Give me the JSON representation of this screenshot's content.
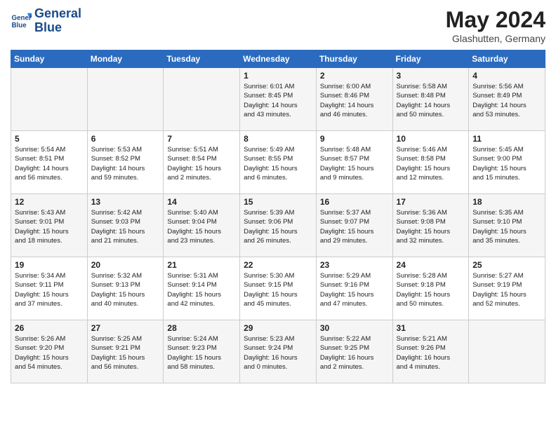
{
  "header": {
    "logo_line1": "General",
    "logo_line2": "Blue",
    "month": "May 2024",
    "location": "Glashutten, Germany"
  },
  "weekdays": [
    "Sunday",
    "Monday",
    "Tuesday",
    "Wednesday",
    "Thursday",
    "Friday",
    "Saturday"
  ],
  "weeks": [
    [
      {
        "day": "",
        "detail": ""
      },
      {
        "day": "",
        "detail": ""
      },
      {
        "day": "",
        "detail": ""
      },
      {
        "day": "1",
        "detail": "Sunrise: 6:01 AM\nSunset: 8:45 PM\nDaylight: 14 hours\nand 43 minutes."
      },
      {
        "day": "2",
        "detail": "Sunrise: 6:00 AM\nSunset: 8:46 PM\nDaylight: 14 hours\nand 46 minutes."
      },
      {
        "day": "3",
        "detail": "Sunrise: 5:58 AM\nSunset: 8:48 PM\nDaylight: 14 hours\nand 50 minutes."
      },
      {
        "day": "4",
        "detail": "Sunrise: 5:56 AM\nSunset: 8:49 PM\nDaylight: 14 hours\nand 53 minutes."
      }
    ],
    [
      {
        "day": "5",
        "detail": "Sunrise: 5:54 AM\nSunset: 8:51 PM\nDaylight: 14 hours\nand 56 minutes."
      },
      {
        "day": "6",
        "detail": "Sunrise: 5:53 AM\nSunset: 8:52 PM\nDaylight: 14 hours\nand 59 minutes."
      },
      {
        "day": "7",
        "detail": "Sunrise: 5:51 AM\nSunset: 8:54 PM\nDaylight: 15 hours\nand 2 minutes."
      },
      {
        "day": "8",
        "detail": "Sunrise: 5:49 AM\nSunset: 8:55 PM\nDaylight: 15 hours\nand 6 minutes."
      },
      {
        "day": "9",
        "detail": "Sunrise: 5:48 AM\nSunset: 8:57 PM\nDaylight: 15 hours\nand 9 minutes."
      },
      {
        "day": "10",
        "detail": "Sunrise: 5:46 AM\nSunset: 8:58 PM\nDaylight: 15 hours\nand 12 minutes."
      },
      {
        "day": "11",
        "detail": "Sunrise: 5:45 AM\nSunset: 9:00 PM\nDaylight: 15 hours\nand 15 minutes."
      }
    ],
    [
      {
        "day": "12",
        "detail": "Sunrise: 5:43 AM\nSunset: 9:01 PM\nDaylight: 15 hours\nand 18 minutes."
      },
      {
        "day": "13",
        "detail": "Sunrise: 5:42 AM\nSunset: 9:03 PM\nDaylight: 15 hours\nand 21 minutes."
      },
      {
        "day": "14",
        "detail": "Sunrise: 5:40 AM\nSunset: 9:04 PM\nDaylight: 15 hours\nand 23 minutes."
      },
      {
        "day": "15",
        "detail": "Sunrise: 5:39 AM\nSunset: 9:06 PM\nDaylight: 15 hours\nand 26 minutes."
      },
      {
        "day": "16",
        "detail": "Sunrise: 5:37 AM\nSunset: 9:07 PM\nDaylight: 15 hours\nand 29 minutes."
      },
      {
        "day": "17",
        "detail": "Sunrise: 5:36 AM\nSunset: 9:08 PM\nDaylight: 15 hours\nand 32 minutes."
      },
      {
        "day": "18",
        "detail": "Sunrise: 5:35 AM\nSunset: 9:10 PM\nDaylight: 15 hours\nand 35 minutes."
      }
    ],
    [
      {
        "day": "19",
        "detail": "Sunrise: 5:34 AM\nSunset: 9:11 PM\nDaylight: 15 hours\nand 37 minutes."
      },
      {
        "day": "20",
        "detail": "Sunrise: 5:32 AM\nSunset: 9:13 PM\nDaylight: 15 hours\nand 40 minutes."
      },
      {
        "day": "21",
        "detail": "Sunrise: 5:31 AM\nSunset: 9:14 PM\nDaylight: 15 hours\nand 42 minutes."
      },
      {
        "day": "22",
        "detail": "Sunrise: 5:30 AM\nSunset: 9:15 PM\nDaylight: 15 hours\nand 45 minutes."
      },
      {
        "day": "23",
        "detail": "Sunrise: 5:29 AM\nSunset: 9:16 PM\nDaylight: 15 hours\nand 47 minutes."
      },
      {
        "day": "24",
        "detail": "Sunrise: 5:28 AM\nSunset: 9:18 PM\nDaylight: 15 hours\nand 50 minutes."
      },
      {
        "day": "25",
        "detail": "Sunrise: 5:27 AM\nSunset: 9:19 PM\nDaylight: 15 hours\nand 52 minutes."
      }
    ],
    [
      {
        "day": "26",
        "detail": "Sunrise: 5:26 AM\nSunset: 9:20 PM\nDaylight: 15 hours\nand 54 minutes."
      },
      {
        "day": "27",
        "detail": "Sunrise: 5:25 AM\nSunset: 9:21 PM\nDaylight: 15 hours\nand 56 minutes."
      },
      {
        "day": "28",
        "detail": "Sunrise: 5:24 AM\nSunset: 9:23 PM\nDaylight: 15 hours\nand 58 minutes."
      },
      {
        "day": "29",
        "detail": "Sunrise: 5:23 AM\nSunset: 9:24 PM\nDaylight: 16 hours\nand 0 minutes."
      },
      {
        "day": "30",
        "detail": "Sunrise: 5:22 AM\nSunset: 9:25 PM\nDaylight: 16 hours\nand 2 minutes."
      },
      {
        "day": "31",
        "detail": "Sunrise: 5:21 AM\nSunset: 9:26 PM\nDaylight: 16 hours\nand 4 minutes."
      },
      {
        "day": "",
        "detail": ""
      }
    ]
  ]
}
